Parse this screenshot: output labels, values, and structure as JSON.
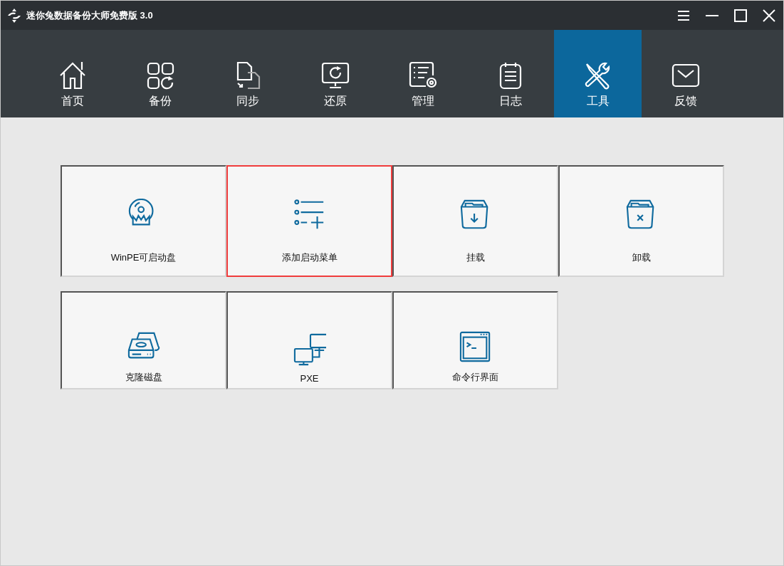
{
  "window": {
    "title": "迷你兔数据备份大师免费版 3.0"
  },
  "nav_tabs": [
    {
      "label": "首页",
      "selected": false
    },
    {
      "label": "备份",
      "selected": false
    },
    {
      "label": "同步",
      "selected": false
    },
    {
      "label": "还原",
      "selected": false
    },
    {
      "label": "管理",
      "selected": false
    },
    {
      "label": "日志",
      "selected": false
    },
    {
      "label": "工具",
      "selected": true
    },
    {
      "label": "反馈",
      "selected": false
    }
  ],
  "tool_rows": [
    [
      {
        "label": "WinPE可启动盘",
        "highlighted": false
      },
      {
        "label": "添加启动菜单",
        "highlighted": true
      },
      {
        "label": "挂载",
        "highlighted": false
      },
      {
        "label": "卸载",
        "highlighted": false
      }
    ],
    [
      {
        "label": "克隆磁盘",
        "highlighted": false
      },
      {
        "label": "PXE",
        "highlighted": false
      },
      {
        "label": "命令行界面",
        "highlighted": false
      }
    ]
  ]
}
